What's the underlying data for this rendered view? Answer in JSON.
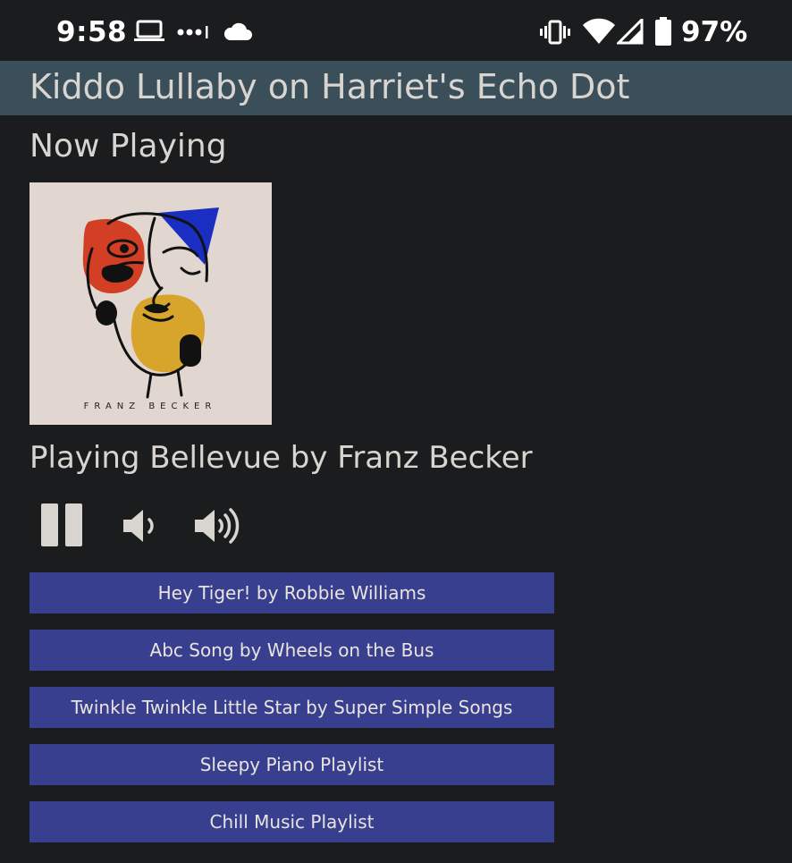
{
  "status_bar": {
    "time": "9:58",
    "battery_percent": "97%",
    "icons": [
      "laptop-icon",
      "more-dots-icon",
      "cloud-icon",
      "vibrate-icon",
      "wifi-icon",
      "signal-icon",
      "battery-icon"
    ]
  },
  "header": {
    "title": "Kiddo Lullaby on Harriet's Echo Dot"
  },
  "now_playing": {
    "heading": "Now Playing",
    "album_artist_text": "FRANZ BECKER",
    "status_text": "Playing Bellevue by Franz Becker"
  },
  "controls": {
    "icons": [
      "pause-icon",
      "volume-down-icon",
      "volume-up-icon"
    ]
  },
  "songs": [
    {
      "label": "Hey Tiger! by Robbie Williams"
    },
    {
      "label": "Abc Song by Wheels on the Bus"
    },
    {
      "label": "Twinkle Twinkle Little Star by Super Simple Songs"
    },
    {
      "label": "Sleepy Piano Playlist"
    },
    {
      "label": "Chill Music Playlist"
    }
  ],
  "colors": {
    "background": "#1b1c1e",
    "title_bar": "#3b4f5b",
    "song_button": "#393f8f",
    "text": "#d8d4cf"
  }
}
